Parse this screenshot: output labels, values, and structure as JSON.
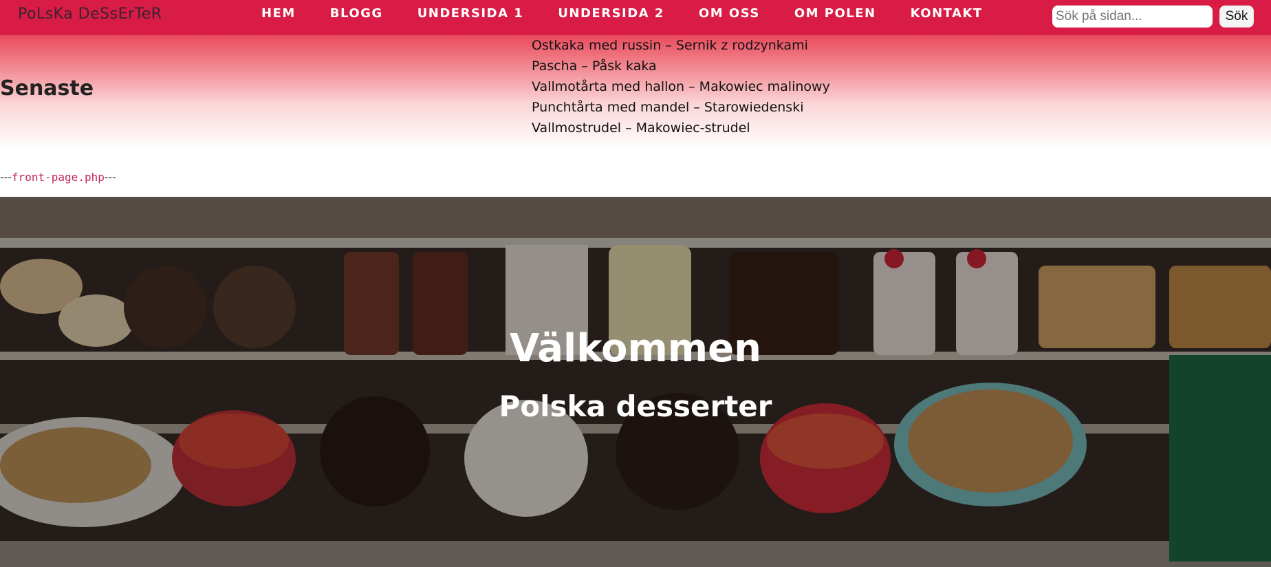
{
  "header": {
    "brand": "PoLsKa DeSsErTeR",
    "nav": [
      "HEM",
      "BLOGG",
      "UNDERSIDA 1",
      "UNDERSIDA 2",
      "OM OSS",
      "OM POLEN",
      "KONTAKT"
    ],
    "search": {
      "placeholder": "Sök på sidan...",
      "button_label": "Sök"
    }
  },
  "recent": {
    "heading": "Senaste",
    "posts": [
      "Ostkaka med russin – Sernik z rodzynkami",
      "Pascha – Påsk kaka",
      "Vallmotårta med hallon – Makowiec malinowy",
      "Punchtårta med mandel – Starowiedenski",
      "Vallmostrudel – Makowiec-strudel"
    ]
  },
  "template_note": {
    "prefix": "---",
    "file": "front-page.php",
    "suffix": "---"
  },
  "hero": {
    "title": "Välkommen",
    "subtitle": "Polska desserter"
  },
  "colors": {
    "nav_bg": "#d81c45",
    "accent_code": "#c0245c"
  }
}
